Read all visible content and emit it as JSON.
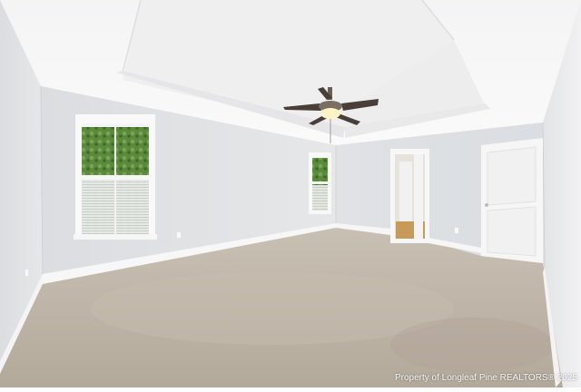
{
  "photo": {
    "watermark": "Property of Longleaf Pine REALTORS® 2025"
  },
  "colors": {
    "ceiling": "#f7f7f7",
    "wall_left": "#e4e5e7",
    "wall_back": "#dfe1e4",
    "wall_right": "#ececed",
    "carpet": "#bdb3a6",
    "trim": "#f8f8f8",
    "door": "#f4f4f4",
    "window_green": "#5f8a3e",
    "fan_blade": "#4a3f38",
    "hallway_floor": "#c79a5a"
  },
  "scene_elements": [
    "tray-ceiling",
    "ceiling-fan",
    "left-window",
    "back-window",
    "open-hallway-door",
    "closed-white-door",
    "beige-carpet"
  ]
}
